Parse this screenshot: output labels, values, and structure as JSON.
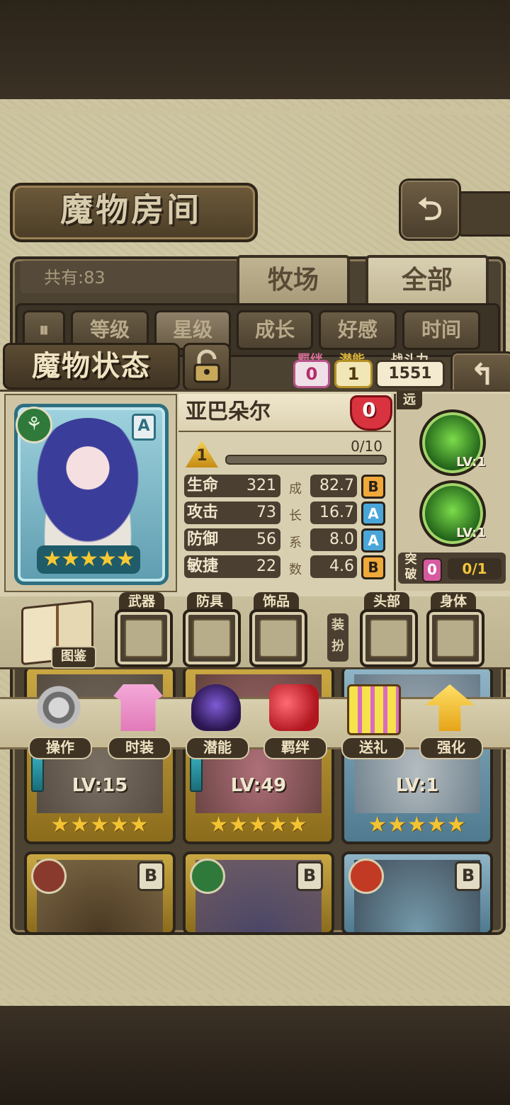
{
  "header": {
    "title": "魔物房间",
    "back_icon": "back-arrow-icon"
  },
  "list": {
    "count_text": "共有:83",
    "tabs": [
      {
        "label": "牧场",
        "selected": false
      },
      {
        "label": "全部",
        "selected": true
      }
    ],
    "sort_buttons": [
      "等级",
      "星级",
      "成长",
      "好感",
      "时间"
    ],
    "cards": [
      {
        "level": "LV:15",
        "stars": "★★★★★",
        "frame": "gold"
      },
      {
        "level": "LV:49",
        "stars": "★★★★★",
        "frame": "gold"
      },
      {
        "level": "LV:1",
        "stars": "★★★★★",
        "frame": "blue"
      },
      {
        "rank": "B",
        "frame": "gold",
        "element": "earth"
      },
      {
        "rank": "B",
        "frame": "gold",
        "element": "grass"
      },
      {
        "rank": "B",
        "frame": "blue",
        "element": "fire"
      }
    ]
  },
  "status": {
    "title": "魔物状态",
    "bond_label": "羁绊",
    "bond_value": "0",
    "potential_label": "潜能",
    "potential_value": "1",
    "power_label": "战斗力",
    "power_value": "1551",
    "name": "亚巴朵尔",
    "heart_value": "0",
    "level": "1",
    "exp": "0/10",
    "exp_fraction": 0,
    "rank": "A",
    "stars": "★★★★★",
    "element": "grass",
    "growth_label_chars": [
      "成",
      "长",
      "系",
      "数"
    ],
    "stats": [
      {
        "name": "生命",
        "value": "321",
        "growth": "82.7",
        "grade": "B"
      },
      {
        "name": "攻击",
        "value": "73",
        "growth": "16.7",
        "grade": "A"
      },
      {
        "name": "防御",
        "value": "56",
        "growth": "8.0",
        "grade": "A"
      },
      {
        "name": "敏捷",
        "value": "22",
        "growth": "4.6",
        "grade": "B"
      }
    ],
    "range": "远",
    "skills": [
      {
        "level": "LV:1",
        "icon": "beast-skill-icon"
      },
      {
        "level": "LV:1",
        "icon": "claw-skill-icon"
      }
    ],
    "breakthrough_label": "突破",
    "breakthrough_count": "0",
    "breakthrough_progress": "0/1"
  },
  "equipment": {
    "book_label": "图鉴",
    "slots": [
      "武器",
      "防具",
      "饰品",
      "头部",
      "身体"
    ],
    "dress_label": "装扮"
  },
  "actions": [
    {
      "label": "操作",
      "icon": "gear-icon"
    },
    {
      "label": "时装",
      "icon": "outfit-icon"
    },
    {
      "label": "潜能",
      "icon": "demon-icon"
    },
    {
      "label": "羁绊",
      "icon": "hearts-icon"
    },
    {
      "label": "送礼",
      "icon": "gift-icon"
    },
    {
      "label": "强化",
      "icon": "upgrade-arrows-icon"
    }
  ]
}
